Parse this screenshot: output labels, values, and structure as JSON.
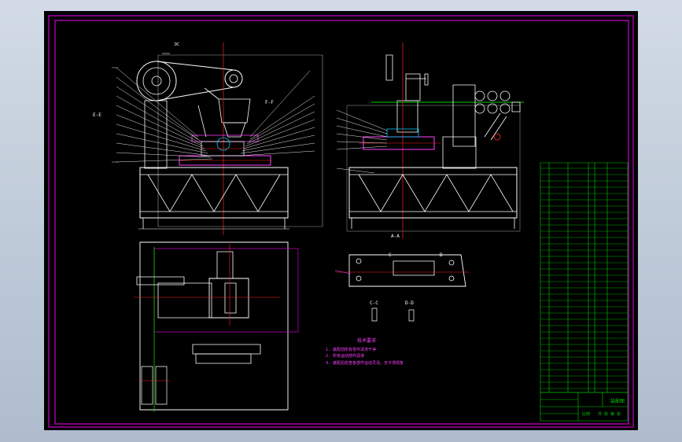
{
  "drawing": {
    "view_labels": {
      "side_view": "E-E",
      "section_a": "A-A",
      "section_c": "C-C",
      "section_d": "D-D",
      "detail_c": "C",
      "detail_d": "D",
      "sheet_mark_left": "DC",
      "front_section_f": "F-F"
    },
    "tech_requirements": {
      "title": "技术要求",
      "lines": [
        "1. 装配前所有零件清洗干净",
        "2. 所有运动部件润滑",
        "3. 装配后检查各部件运动灵活，无卡滞现象"
      ]
    },
    "title_block": {
      "drawing_name": "装配图",
      "scale_label": "比例",
      "sheet_label": "共 张 第 张"
    },
    "colors": {
      "frame": "#c800c8",
      "lines": "#ffffff",
      "green": "#00d000",
      "red": "#ff2020",
      "yellow": "#ffff00",
      "cyan": "#00c8ff",
      "magenta": "#ff40ff"
    }
  }
}
